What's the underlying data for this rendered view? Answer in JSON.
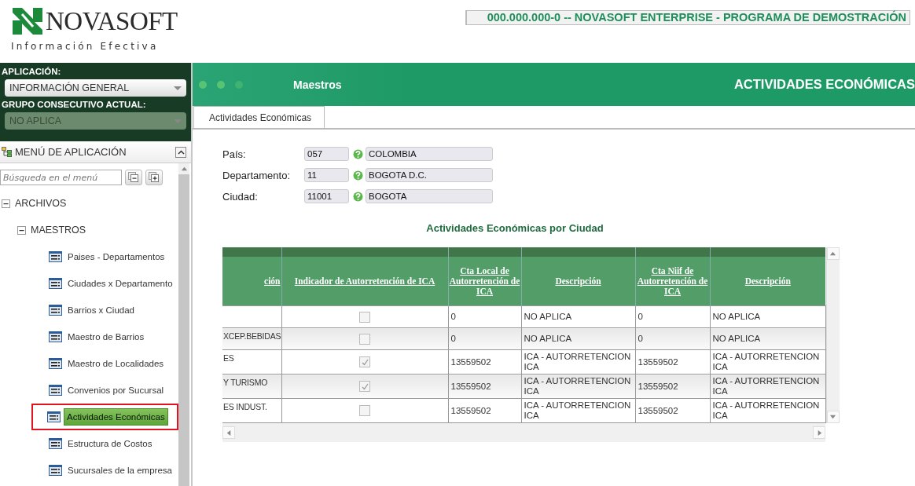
{
  "header": {
    "logo_text": "NOVASOFT",
    "tagline": "Información Efectiva",
    "banner": "000.000.000-0 -- NOVASOFT ENTERPRISE - PROGRAMA DE DEMOSTRACIÓN"
  },
  "sidebar": {
    "application_label": "APLICACIÓN:",
    "application_value": "INFORMACIÓN GENERAL",
    "group_label": "GRUPO CONSECUTIVO ACTUAL:",
    "group_value": "NO APLICA",
    "group_disabled": true,
    "menu_title": "MENÚ DE APLICACIÓN",
    "search_placeholder": "Búsqueda en el menú",
    "tree": [
      {
        "label": "ARCHIVOS",
        "expanded": true,
        "children": [
          {
            "label": "MAESTROS",
            "expanded": true,
            "children": [
              {
                "label": "Paises - Departamentos",
                "selected": false
              },
              {
                "label": "Ciudades x Departamento",
                "selected": false
              },
              {
                "label": "Barrios x Ciudad",
                "selected": false
              },
              {
                "label": "Maestro de Barrios",
                "selected": false
              },
              {
                "label": "Maestro de Localidades",
                "selected": false
              },
              {
                "label": "Convenios por Sucursal",
                "selected": false
              },
              {
                "label": "Actividades Económicas",
                "selected": true
              },
              {
                "label": "Estructura de Costos",
                "selected": false
              },
              {
                "label": "Sucursales de la empresa",
                "selected": false
              }
            ]
          }
        ]
      }
    ]
  },
  "panel": {
    "section": "Maestros",
    "title": "ACTIVIDADES ECONÓMICAS",
    "tabs": [
      {
        "label": "Actividades Económicas",
        "selected": true
      }
    ],
    "fields": [
      {
        "label": "País:",
        "code": "057",
        "name": "COLOMBIA"
      },
      {
        "label": "Departamento:",
        "code": "11",
        "name": "BOGOTA D.C."
      },
      {
        "label": "Ciudad:",
        "code": "11001",
        "name": "BOGOTA"
      }
    ],
    "grid_title": "Actividades Económicas por Ciudad",
    "table": {
      "columns": [
        "ción",
        "Indicador de Autorretención de ICA",
        "Cta Local de Autorretención de ICA",
        "Descripción",
        "Cta Niif de Autorretención de ICA",
        "Descripción"
      ],
      "rows": [
        {
          "checked": false,
          "cta_local": "0",
          "descripcion_local": "NO APLICA",
          "cta_niif": "0",
          "descripcion_niif": "NO APLICA"
        },
        {
          "name": "XCEP.BEBIDAS",
          "checked": false,
          "cta_local": "0",
          "descripcion_local": "NO APLICA",
          "cta_niif": "0",
          "descripcion_niif": "NO APLICA"
        },
        {
          "name": "ES",
          "checked": true,
          "cta_local": "13559502",
          "descripcion_local": "ICA - AUTORRETENCION ICA",
          "cta_niif": "13559502",
          "descripcion_niif": "ICA - AUTORRETENCION ICA"
        },
        {
          "name": "Y TURISMO",
          "checked": true,
          "cta_local": "13559502",
          "descripcion_local": "ICA - AUTORRETENCION ICA",
          "cta_niif": "13559502",
          "descripcion_niif": "ICA - AUTORRETENCION ICA"
        },
        {
          "name": "ES INDUST.",
          "checked": false,
          "cta_local": "13559502",
          "descripcion_local": "ICA - AUTORRETENCION ICA",
          "cta_niif": "13559502",
          "descripcion_niif": "ICA - AUTORRETENCION ICA"
        }
      ]
    }
  }
}
